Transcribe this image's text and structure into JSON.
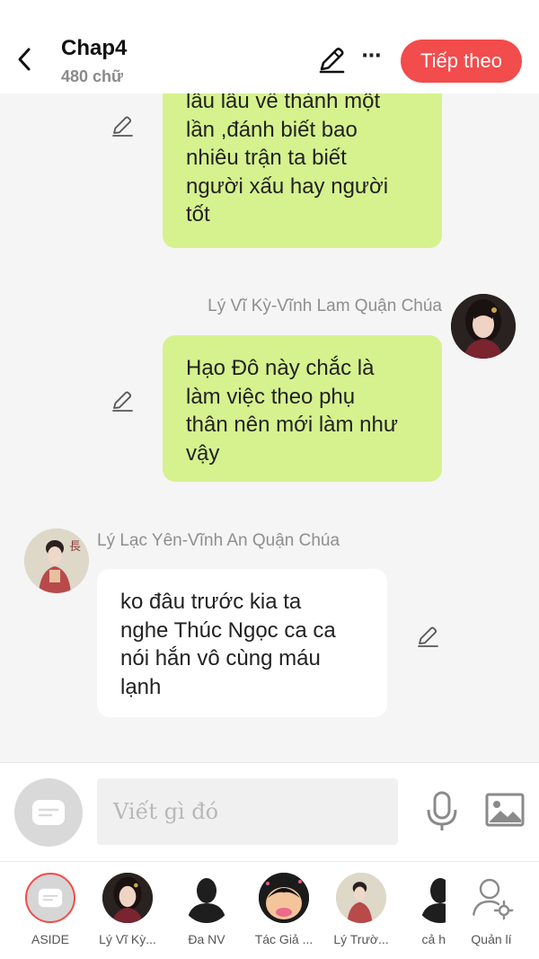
{
  "header": {
    "title": "Chap4",
    "word_count": "480 chữ",
    "next_label": "Tiếp theo",
    "more_glyph": "⋯"
  },
  "messages": [
    {
      "side": "right",
      "sender": "",
      "lines": [
        "lâu lâu về thành một",
        "lần ,đánh biết bao",
        "nhiêu trận ta biết",
        "người xấu hay người",
        "tốt"
      ]
    },
    {
      "side": "right",
      "sender": "Lý Vĩ Kỳ-Vĩnh Lam Quận Chúa",
      "lines": [
        "Hạo Đô này chắc là",
        "làm việc theo phụ",
        "thân nên mới làm như",
        "vậy"
      ]
    },
    {
      "side": "left",
      "sender": "Lý Lạc Yên-Vĩnh An Quận Chúa",
      "lines": [
        "ko đâu trước kia ta",
        "nghe Thúc Ngọc ca ca",
        "nói hắn vô cùng máu",
        "lạnh"
      ]
    }
  ],
  "input": {
    "placeholder": "Viết gì đó"
  },
  "cast": [
    {
      "label": "ASIDE"
    },
    {
      "label": "Lý Vĩ Kỳ..."
    },
    {
      "label": "Đa NV"
    },
    {
      "label": "Tác Giả ..."
    },
    {
      "label": "Lý Trườ..."
    },
    {
      "label": "cả h"
    },
    {
      "label": "Quản lí"
    }
  ],
  "colors": {
    "accent": "#f24c4c",
    "bubble_green": "#d5f28e",
    "bubble_white": "#ffffff",
    "background": "#f5f5f5"
  }
}
